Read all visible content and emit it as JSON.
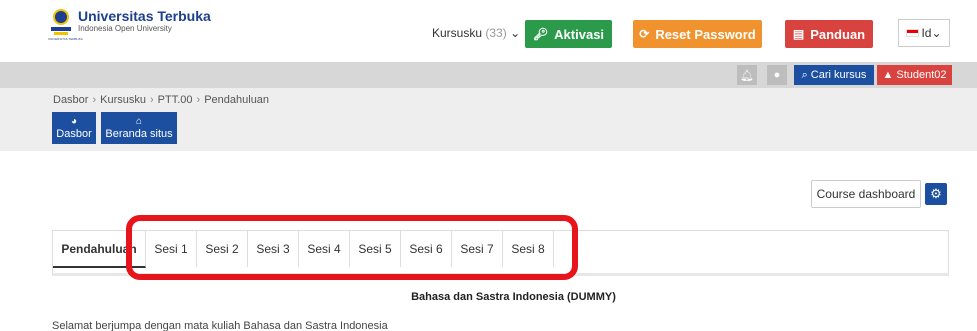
{
  "header": {
    "logo_title": "Universitas Terbuka",
    "logo_subtitle": "Indonesia Open University",
    "logo_mark_text": "UNIVERSITAS TERBUKA",
    "kursusku_label": "Kursusku",
    "kursusku_count": "(33)",
    "aktivasi_label": "Aktivasi",
    "reset_label": "Reset Password",
    "panduan_label": "Panduan",
    "lang_label": "Id"
  },
  "navbar": {
    "search_label": "Cari kursus",
    "user_label": "Student02"
  },
  "breadcrumb": [
    "Dasbor",
    "Kursusku",
    "PTT.00",
    "Pendahuluan"
  ],
  "quick_buttons": {
    "dasbor": "Dasbor",
    "beranda": "Beranda situs"
  },
  "course_dashboard_label": "Course dashboard",
  "tabs": [
    {
      "label": "Pendahuluan",
      "active": true
    },
    {
      "label": "Sesi 1"
    },
    {
      "label": "Sesi 2"
    },
    {
      "label": "Sesi 3"
    },
    {
      "label": "Sesi 4"
    },
    {
      "label": "Sesi 5"
    },
    {
      "label": "Sesi 6"
    },
    {
      "label": "Sesi 7"
    },
    {
      "label": "Sesi 8"
    }
  ],
  "course_title": "Bahasa dan Sastra Indonesia (DUMMY)",
  "welcome_text": "Selamat berjumpa dengan mata kuliah  Bahasa dan Sastra Indonesia",
  "colors": {
    "primary": "#1d4fa0",
    "success": "#2b9a4a",
    "warning": "#f0922e",
    "danger": "#d9433f",
    "highlight": "#e8141c"
  }
}
